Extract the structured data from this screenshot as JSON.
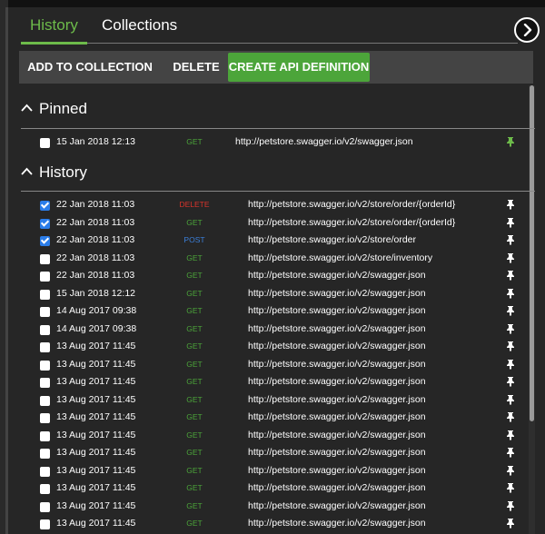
{
  "tabs": [
    {
      "label": "History",
      "active": true
    },
    {
      "label": "Collections",
      "active": false
    }
  ],
  "toolbar": {
    "add_label": "ADD TO COLLECTION",
    "delete_label": "DELETE",
    "create_label": "CREATE API DEFINITION"
  },
  "pinned": {
    "title": "Pinned",
    "items": [
      {
        "date": "15 Jan 2018 12:13",
        "method": "GET",
        "url": "http://petstore.swagger.io/v2/swagger.json",
        "checked": false
      }
    ]
  },
  "history": {
    "title": "History",
    "items": [
      {
        "date": "22 Jan 2018 11:03",
        "method": "DELETE",
        "url": "http://petstore.swagger.io/v2/store/order/{orderId}",
        "checked": true
      },
      {
        "date": "22 Jan 2018 11:03",
        "method": "GET",
        "url": "http://petstore.swagger.io/v2/store/order/{orderId}",
        "checked": true
      },
      {
        "date": "22 Jan 2018 11:03",
        "method": "POST",
        "url": "http://petstore.swagger.io/v2/store/order",
        "checked": true
      },
      {
        "date": "22 Jan 2018 11:03",
        "method": "GET",
        "url": "http://petstore.swagger.io/v2/store/inventory",
        "checked": false
      },
      {
        "date": "22 Jan 2018 11:03",
        "method": "GET",
        "url": "http://petstore.swagger.io/v2/swagger.json",
        "checked": false
      },
      {
        "date": "15 Jan 2018 12:12",
        "method": "GET",
        "url": "http://petstore.swagger.io/v2/swagger.json",
        "checked": false
      },
      {
        "date": "14 Aug 2017 09:38",
        "method": "GET",
        "url": "http://petstore.swagger.io/v2/swagger.json",
        "checked": false
      },
      {
        "date": "14 Aug 2017 09:38",
        "method": "GET",
        "url": "http://petstore.swagger.io/v2/swagger.json",
        "checked": false
      },
      {
        "date": "13 Aug 2017 11:45",
        "method": "GET",
        "url": "http://petstore.swagger.io/v2/swagger.json",
        "checked": false
      },
      {
        "date": "13 Aug 2017 11:45",
        "method": "GET",
        "url": "http://petstore.swagger.io/v2/swagger.json",
        "checked": false
      },
      {
        "date": "13 Aug 2017 11:45",
        "method": "GET",
        "url": "http://petstore.swagger.io/v2/swagger.json",
        "checked": false
      },
      {
        "date": "13 Aug 2017 11:45",
        "method": "GET",
        "url": "http://petstore.swagger.io/v2/swagger.json",
        "checked": false
      },
      {
        "date": "13 Aug 2017 11:45",
        "method": "GET",
        "url": "http://petstore.swagger.io/v2/swagger.json",
        "checked": false
      },
      {
        "date": "13 Aug 2017 11:45",
        "method": "GET",
        "url": "http://petstore.swagger.io/v2/swagger.json",
        "checked": false
      },
      {
        "date": "13 Aug 2017 11:45",
        "method": "GET",
        "url": "http://petstore.swagger.io/v2/swagger.json",
        "checked": false
      },
      {
        "date": "13 Aug 2017 11:45",
        "method": "GET",
        "url": "http://petstore.swagger.io/v2/swagger.json",
        "checked": false
      },
      {
        "date": "13 Aug 2017 11:45",
        "method": "GET",
        "url": "http://petstore.swagger.io/v2/swagger.json",
        "checked": false
      },
      {
        "date": "13 Aug 2017 11:45",
        "method": "GET",
        "url": "http://petstore.swagger.io/v2/swagger.json",
        "checked": false
      },
      {
        "date": "13 Aug 2017 11:45",
        "method": "GET",
        "url": "http://petstore.swagger.io/v2/swagger.json",
        "checked": false
      }
    ]
  },
  "icons": {
    "nav": "chevron-right-icon",
    "section_toggle": "chevron-up-icon",
    "pin": "pin-icon",
    "checkbox": "checkbox-icon"
  },
  "colors": {
    "accent_green": "#6dbb4a",
    "button_green": "#4ca53a",
    "get": "#4ca53a",
    "post": "#3b7fd9",
    "delete": "#d9342b",
    "checkbox_checked": "#2b7de9"
  }
}
